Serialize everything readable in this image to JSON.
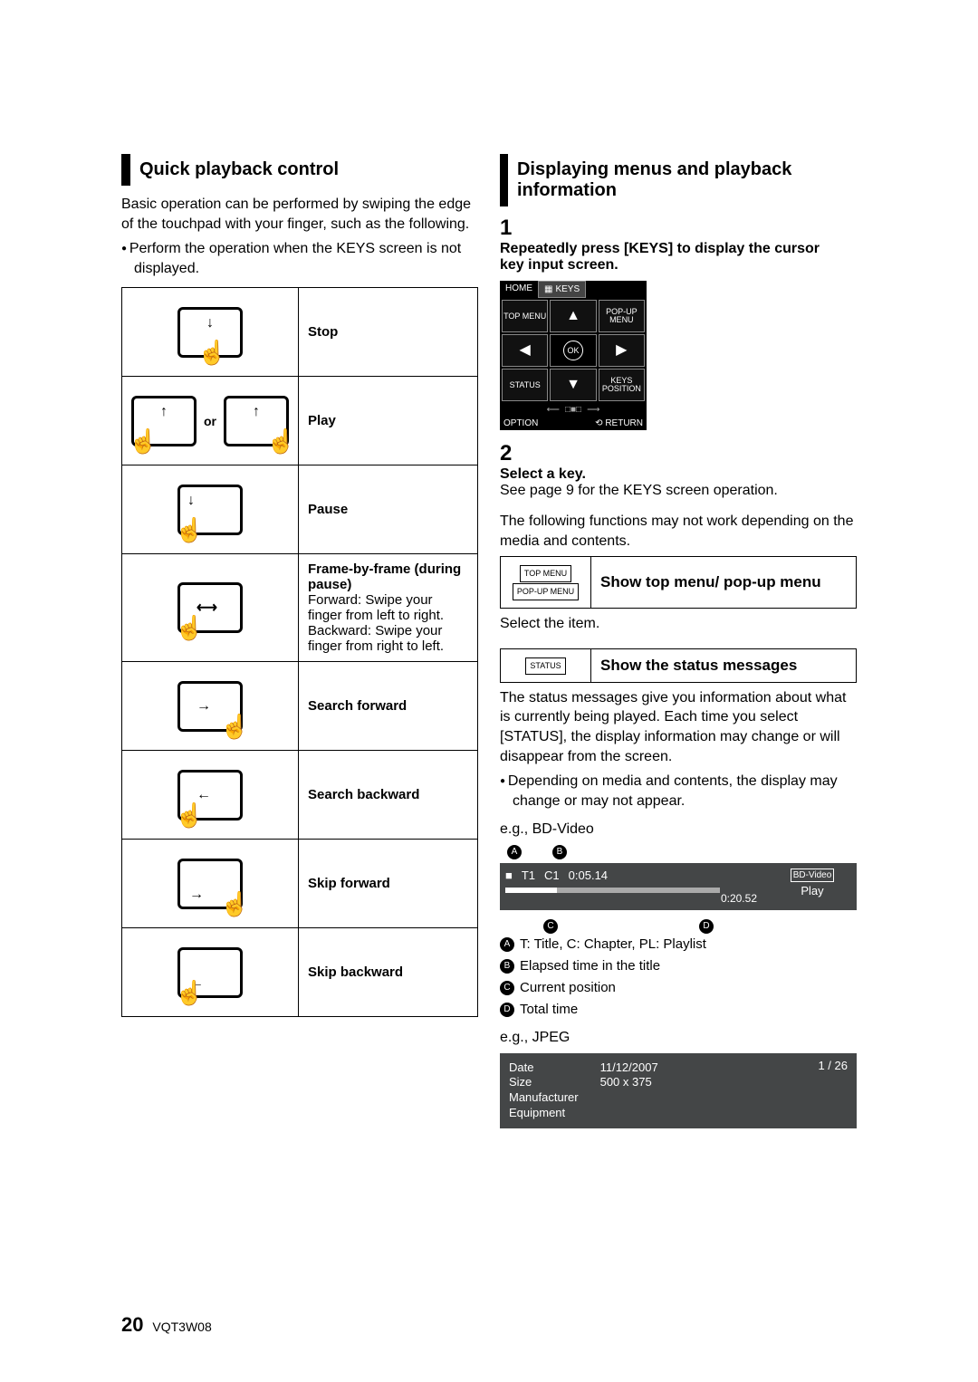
{
  "left": {
    "heading": "Quick playback control",
    "intro": "Basic operation can be performed by swiping the edge of the touchpad with your finger, such as the following.",
    "bullet1": "Perform the operation when the KEYS screen is not displayed.",
    "gestures": {
      "stop": "Stop",
      "play": "Play",
      "or": "or",
      "pause": "Pause",
      "frame_title": "Frame-by-frame (during pause)",
      "frame_fwd": "Forward: Swipe your finger from left to right.",
      "frame_bwd": "Backward: Swipe your finger from right to left.",
      "search_fwd": "Search forward",
      "search_bwd": "Search backward",
      "skip_fwd": "Skip forward",
      "skip_bwd": "Skip backward"
    }
  },
  "right": {
    "heading": "Displaying menus and playback information",
    "step1": "Repeatedly press [KEYS] to display the cursor key input screen.",
    "keys_widget": {
      "home": "HOME",
      "keys_tab": "KEYS",
      "top_menu": "TOP\nMENU",
      "popup_menu": "POP-UP\nMENU",
      "ok": "OK",
      "status": "STATUS",
      "keys_pos": "KEYS\nPOSITION",
      "option": "OPTION",
      "return": "RETURN"
    },
    "step2": "Select a key.",
    "step2_note": "See page 9 for the KEYS screen operation.",
    "disclaimer": "The following functions may not work depending on the media and contents.",
    "func1_keys": {
      "top": "TOP\nMENU",
      "popup": "POP-UP\nMENU"
    },
    "func1_label": "Show top menu/\npop-up menu",
    "func1_after": "Select the item.",
    "func2_key": "STATUS",
    "func2_label": "Show the status messages",
    "status_para": "The status messages give you information about what is currently being played. Each time you select [STATUS], the display information may change or will disappear from the screen.",
    "status_bullet": "Depending on media and contents, the display may change or may not appear.",
    "eg_bd": "e.g., BD-Video",
    "callouts": {
      "A": "A",
      "B": "B",
      "C": "C",
      "D": "D"
    },
    "osd_bd": {
      "t": "T1",
      "c": "C1",
      "elapsed": "0:05.14",
      "total": "0:20.52",
      "tag": "BD-Video",
      "state": "Play",
      "stopglyph": "■"
    },
    "legend": {
      "A": "T: Title, C: Chapter, PL: Playlist",
      "B": "Elapsed time in the title",
      "C": "Current position",
      "D": "Total time"
    },
    "eg_jpeg": "e.g., JPEG",
    "osd_jpeg": {
      "date_k": "Date",
      "date_v": "11/12/2007",
      "size_k": "Size",
      "size_v": "500 x 375",
      "mfr": "Manufacturer",
      "eq": "Equipment",
      "counter": "1 / 26"
    }
  },
  "footer": {
    "page": "20",
    "code": "VQT3W08"
  }
}
